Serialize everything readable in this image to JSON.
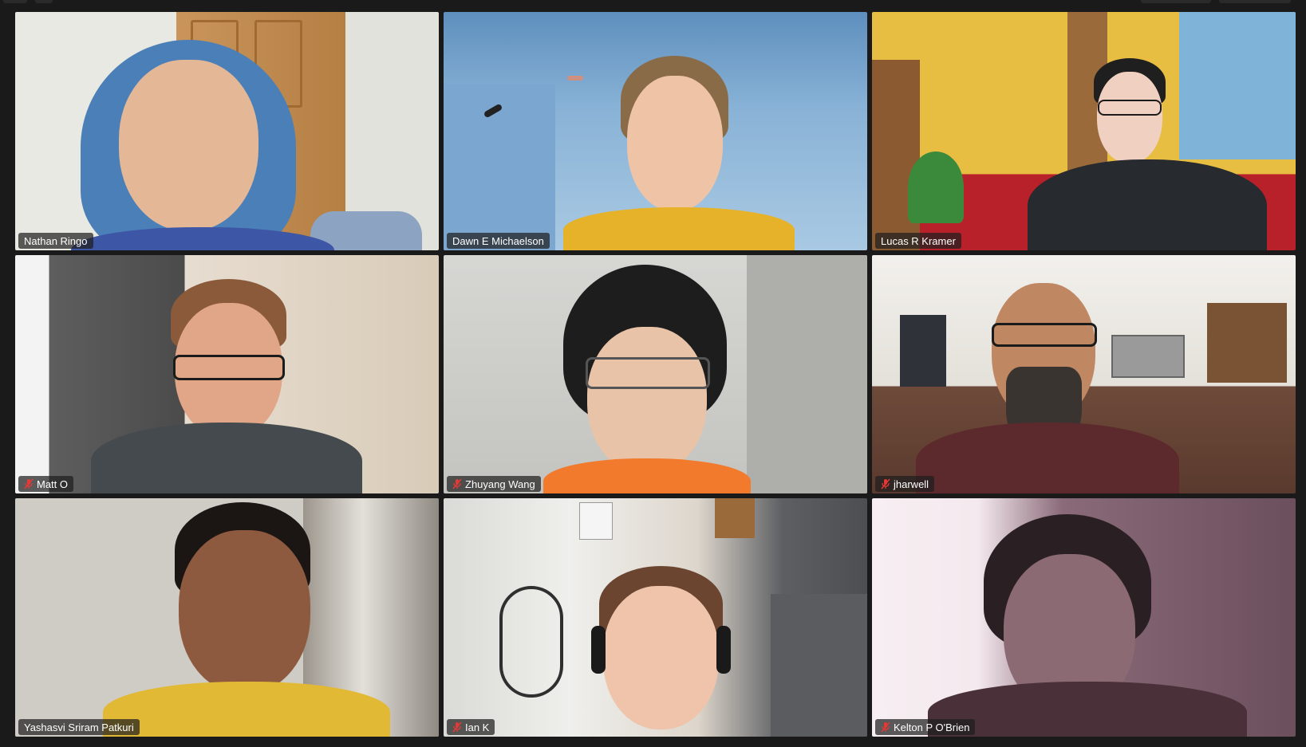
{
  "app": {
    "title": "",
    "layout": "gallery-view",
    "active_speaker_color": "#22c55e"
  },
  "participants": [
    {
      "name": "Nathan Ringo",
      "muted": false,
      "active": false,
      "icon": "mic-muted-icon"
    },
    {
      "name": "Dawn E Michaelson",
      "muted": false,
      "active": false,
      "icon": "mic-muted-icon"
    },
    {
      "name": "Lucas R Kramer",
      "muted": false,
      "active": false,
      "icon": "mic-muted-icon"
    },
    {
      "name": "Matt O",
      "muted": true,
      "active": false,
      "icon": "mic-muted-icon"
    },
    {
      "name": "Zhuyang Wang",
      "muted": true,
      "active": false,
      "icon": "mic-muted-icon"
    },
    {
      "name": "jharwell",
      "muted": true,
      "active": false,
      "icon": "mic-muted-icon"
    },
    {
      "name": "Yashasvi Sriram Patkuri",
      "muted": false,
      "active": true,
      "icon": "mic-muted-icon"
    },
    {
      "name": "Ian K",
      "muted": true,
      "active": false,
      "icon": "mic-muted-icon"
    },
    {
      "name": "Kelton P O'Brien",
      "muted": true,
      "active": false,
      "icon": "mic-muted-icon"
    }
  ]
}
